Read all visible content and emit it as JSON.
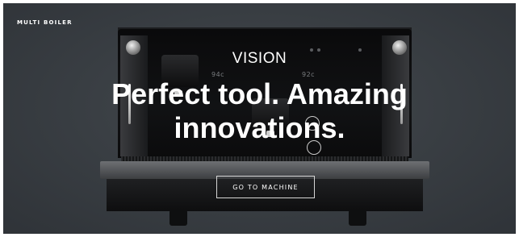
{
  "section": {
    "eyebrow": "MULTI BOILER"
  },
  "machine": {
    "brand": "VISION",
    "display_left": "94c",
    "display_right": "92c"
  },
  "hero": {
    "headline_line1": "Perfect tool. Amazing",
    "headline_line2": "innovations.",
    "cta_label": "GO TO MACHINE"
  },
  "colors": {
    "background": "#3a3f44",
    "text": "#ffffff",
    "button_border": "#d6d6d6"
  }
}
